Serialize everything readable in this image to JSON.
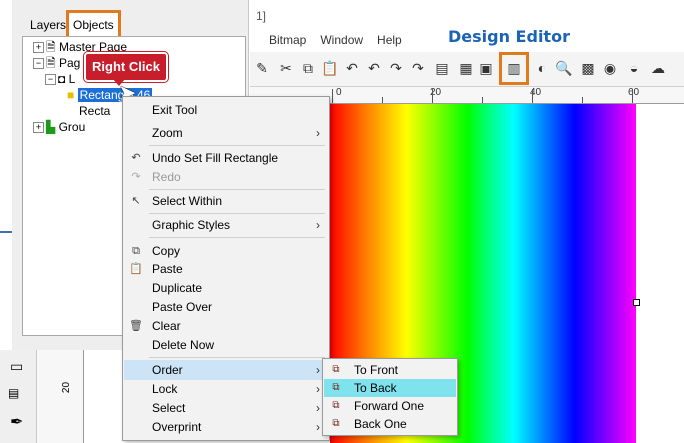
{
  "title_fragment": "1]",
  "menubar": {
    "items": [
      "Bitmap",
      "Window",
      "Help"
    ]
  },
  "annotation": {
    "design_editor": "Design Editor",
    "right_click": "Right Click"
  },
  "ruler": {
    "ticks": [
      "0",
      "20",
      "40",
      "60"
    ],
    "vertical": "20"
  },
  "panel": {
    "tabs": {
      "layers": "Layers",
      "objects": "Objects"
    },
    "tree": {
      "master_page": "Master Page",
      "page": "Pag",
      "layer": "L",
      "rectangle_selected": "Rectangle 46",
      "rectangle": "Recta",
      "group": "Grou"
    }
  },
  "context_menu": {
    "exit_tool": "Exit Tool",
    "zoom": "Zoom",
    "undo": "Undo Set Fill Rectangle",
    "redo": "Redo",
    "select_within": "Select Within",
    "graphic_styles": "Graphic Styles",
    "copy": "Copy",
    "paste": "Paste",
    "duplicate": "Duplicate",
    "paste_over": "Paste Over",
    "clear": "Clear",
    "delete_now": "Delete Now",
    "order": "Order",
    "lock": "Lock",
    "select": "Select",
    "overprint": "Overprint"
  },
  "order_submenu": {
    "to_front": "To Front",
    "to_back": "To Back",
    "forward_one": "Forward One",
    "back_one": "Back One"
  },
  "colors": {
    "accent": "#e07a1d",
    "selection": "#1c6fd6",
    "callout": "#c81e2c",
    "hover": "#7fe3ee"
  }
}
